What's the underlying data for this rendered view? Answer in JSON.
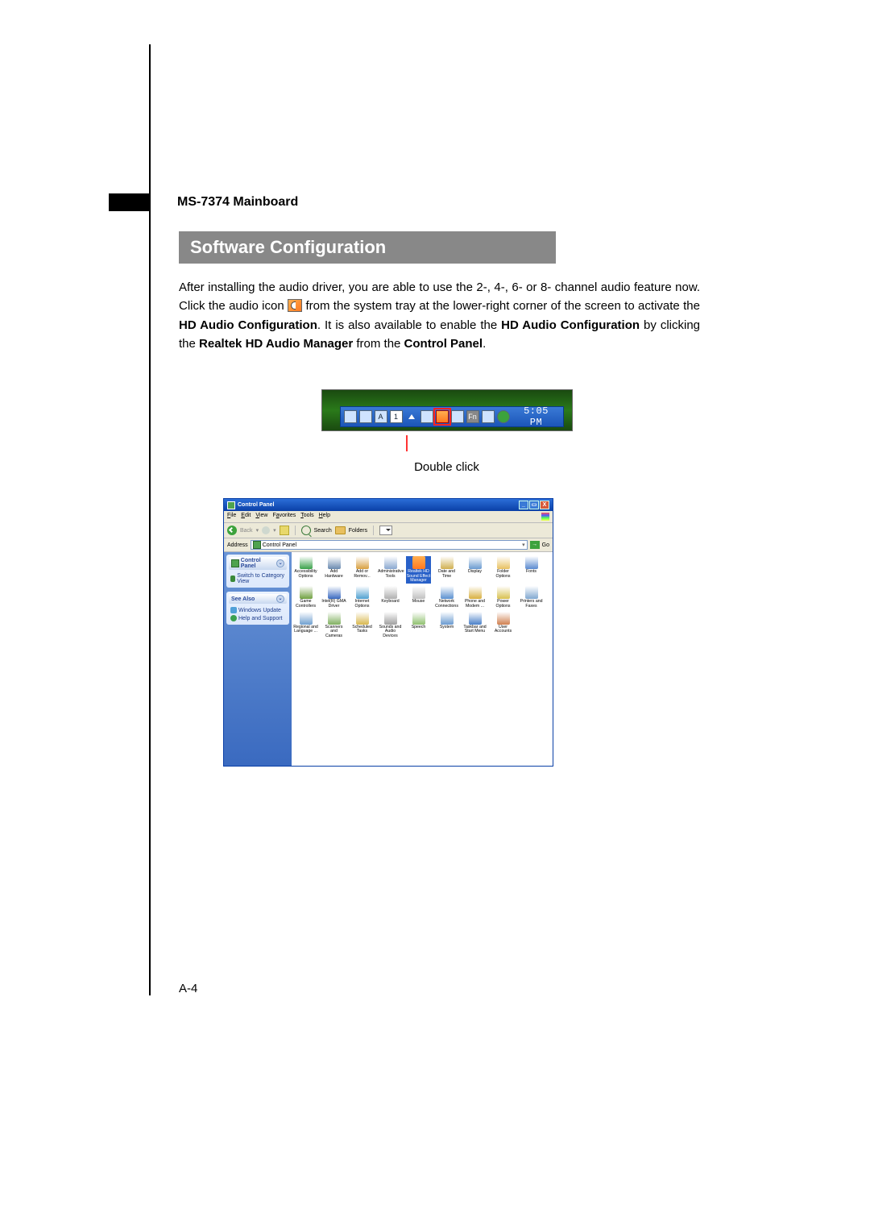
{
  "header": {
    "model": "MS-7374 Mainboard"
  },
  "title": "Software Configuration",
  "body": {
    "p1a": "After installing the audio driver, you are able to use the 2-, 4-, 6- or 8- channel audio feature now. Click the audio icon ",
    "p1b": " from the system tray at the lower-right corner of the screen to activate the ",
    "b1": "HD Audio Configuration",
    "p1c": ". It is also available to enable the ",
    "b2": "HD Audio Configuration",
    "p1d": " by clicking the ",
    "b3": "Realtek HD Audio Manager",
    "p1e": " from the ",
    "b4": "Control Panel",
    "p1f": "."
  },
  "systray": {
    "time": "5:05 PM",
    "icons": [
      "net",
      "shield",
      "A",
      "1",
      "speaker",
      "audio",
      "disp",
      "Fn",
      "cfg",
      "refresh"
    ]
  },
  "double_click_label": "Double click",
  "control_panel": {
    "title": "Control Panel",
    "menu": [
      "File",
      "Edit",
      "View",
      "Favorites",
      "Tools",
      "Help"
    ],
    "toolbar": {
      "back": "Back",
      "search": "Search",
      "folders": "Folders"
    },
    "address_label": "Address",
    "address_value": "Control Panel",
    "go": "Go",
    "side": {
      "panel1": {
        "title": "Control Panel",
        "link1": "Switch to Category View"
      },
      "panel2": {
        "title": "See Also",
        "link1": "Windows Update",
        "link2": "Help and Support"
      }
    },
    "items": [
      {
        "label": "Accessibility Options",
        "icon": "#3aa24a"
      },
      {
        "label": "Add Hardware",
        "icon": "#6a8ab0"
      },
      {
        "label": "Add or Remov...",
        "icon": "#d8a040"
      },
      {
        "label": "Administrative Tools",
        "icon": "#8aa8d0"
      },
      {
        "label": "Realtek HD Sound Effect Manager",
        "icon": "#ff7820",
        "selected": true
      },
      {
        "label": "Date and Time",
        "icon": "#d0b050"
      },
      {
        "label": "Display",
        "icon": "#6a9ad0"
      },
      {
        "label": "Folder Options",
        "icon": "#e8c060"
      },
      {
        "label": "Fonts",
        "icon": "#5a8ad0"
      },
      {
        "label": "Game Controllers",
        "icon": "#70a040"
      },
      {
        "label": "Intel(R) GMA Driver",
        "icon": "#3a6ac0"
      },
      {
        "label": "Internet Options",
        "icon": "#50a0d0"
      },
      {
        "label": "Keyboard",
        "icon": "#b0b0b0"
      },
      {
        "label": "Mouse",
        "icon": "#c0c0c0"
      },
      {
        "label": "Network Connections",
        "icon": "#5a90d0"
      },
      {
        "label": "Phone and Modem ...",
        "icon": "#d8b040"
      },
      {
        "label": "Power Options",
        "icon": "#d8c050"
      },
      {
        "label": "Printers and Faxes",
        "icon": "#80a8d0"
      },
      {
        "label": "Regional and Language ...",
        "icon": "#70a0d0"
      },
      {
        "label": "Scanners and Cameras",
        "icon": "#80b060"
      },
      {
        "label": "Scheduled Tasks",
        "icon": "#d8b850"
      },
      {
        "label": "Sounds and Audio Devices",
        "icon": "#a0a0a0"
      },
      {
        "label": "Speech",
        "icon": "#90c070"
      },
      {
        "label": "System",
        "icon": "#6a9ad0"
      },
      {
        "label": "Taskbar and Start Menu",
        "icon": "#4a80c8"
      },
      {
        "label": "User Accounts",
        "icon": "#d08050"
      }
    ]
  },
  "page_number": "A-4"
}
